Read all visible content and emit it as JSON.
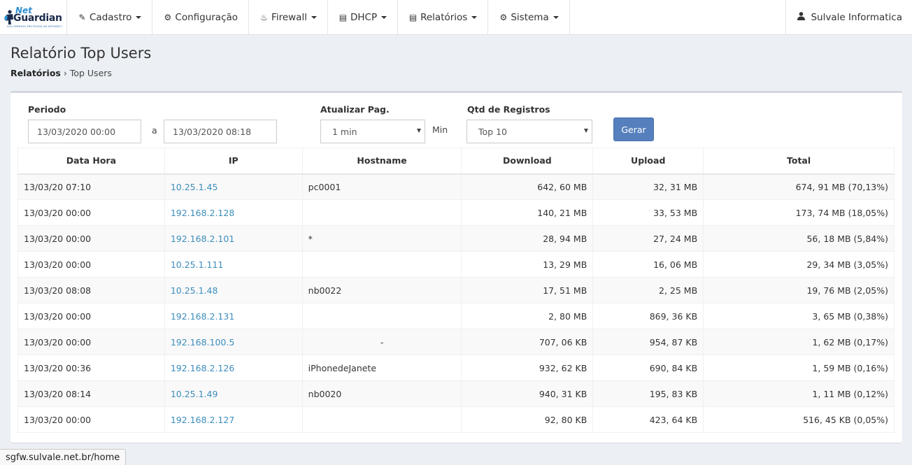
{
  "brand": {
    "logo_line1": "Net",
    "logo_line2": "Guardian",
    "logo_tagline": "SUA EMPRESA PROTEGIDA NA INTERNET!"
  },
  "nav": {
    "items": [
      {
        "label": "Cadastro",
        "icon": "edit-icon",
        "glyph": "✎",
        "dropdown": true
      },
      {
        "label": "Configuração",
        "icon": "gear-icon",
        "glyph": "⚙",
        "dropdown": false
      },
      {
        "label": "Firewall",
        "icon": "fire-icon",
        "glyph": "♨",
        "dropdown": true
      },
      {
        "label": "DHCP",
        "icon": "file-icon",
        "glyph": "▤",
        "dropdown": true
      },
      {
        "label": "Relatórios",
        "icon": "report-icon",
        "glyph": "▤",
        "dropdown": true
      },
      {
        "label": "Sistema",
        "icon": "gears-icon",
        "glyph": "⚙",
        "dropdown": true
      }
    ],
    "user": {
      "label": "Sulvale Informatica",
      "icon": "user-icon",
      "glyph": "👤"
    }
  },
  "page": {
    "title": "Relatório Top Users",
    "breadcrumb_parent": "Relatórios",
    "breadcrumb_separator": "›",
    "breadcrumb_current": "Top Users"
  },
  "filters": {
    "periodo_label": "Periodo",
    "date_from": "13/03/2020 00:00",
    "date_sep": "a",
    "date_to": "13/03/2020 08:18",
    "atualizar_label": "Atualizar Pag.",
    "atualizar_value": "1 min",
    "atualizar_unit": "Min",
    "qtd_label": "Qtd de Registros",
    "qtd_value": "Top 10",
    "gerar_label": "Gerar"
  },
  "table": {
    "columns": [
      "Data Hora",
      "IP",
      "Hostname",
      "Download",
      "Upload",
      "Total"
    ],
    "rows": [
      {
        "datahora": "13/03/20 07:10",
        "ip": "10.25.1.45",
        "hostname": "pc0001",
        "hostname_align": "left",
        "download": "642, 60 MB",
        "upload": "32, 31 MB",
        "total": "674, 91 MB (70,13%)"
      },
      {
        "datahora": "13/03/20 00:00",
        "ip": "192.168.2.128",
        "hostname": "",
        "hostname_align": "left",
        "download": "140, 21 MB",
        "upload": "33, 53 MB",
        "total": "173, 74 MB (18,05%)"
      },
      {
        "datahora": "13/03/20 00:00",
        "ip": "192.168.2.101",
        "hostname": "*",
        "hostname_align": "left",
        "download": "28, 94 MB",
        "upload": "27, 24 MB",
        "total": "56, 18 MB (5,84%)"
      },
      {
        "datahora": "13/03/20 00:00",
        "ip": "10.25.1.111",
        "hostname": "",
        "hostname_align": "left",
        "download": "13, 29 MB",
        "upload": "16, 06 MB",
        "total": "29, 34 MB (3,05%)"
      },
      {
        "datahora": "13/03/20 08:08",
        "ip": "10.25.1.48",
        "hostname": "nb0022",
        "hostname_align": "left",
        "download": "17, 51 MB",
        "upload": "2, 25 MB",
        "total": "19, 76 MB (2,05%)"
      },
      {
        "datahora": "13/03/20 00:00",
        "ip": "192.168.2.131",
        "hostname": "",
        "hostname_align": "left",
        "download": "2, 80 MB",
        "upload": "869, 36 KB",
        "total": "3, 65 MB (0,38%)"
      },
      {
        "datahora": "13/03/20 00:00",
        "ip": "192.168.100.5",
        "hostname": "-",
        "hostname_align": "center",
        "download": "707, 06 KB",
        "upload": "954, 87 KB",
        "total": "1, 62 MB (0,17%)"
      },
      {
        "datahora": "13/03/20 00:36",
        "ip": "192.168.2.126",
        "hostname": "iPhonedeJanete",
        "hostname_align": "left",
        "download": "932, 62 KB",
        "upload": "690, 84 KB",
        "total": "1, 59 MB (0,16%)"
      },
      {
        "datahora": "13/03/20 08:14",
        "ip": "10.25.1.49",
        "hostname": "nb0020",
        "hostname_align": "left",
        "download": "940, 31 KB",
        "upload": "195, 83 KB",
        "total": "1, 11 MB (0,12%)"
      },
      {
        "datahora": "13/03/20 00:00",
        "ip": "192.168.2.127",
        "hostname": "",
        "hostname_align": "left",
        "download": "92, 80 KB",
        "upload": "423, 64 KB",
        "total": "516, 45 KB (0,05%)"
      }
    ]
  },
  "status_bar": {
    "url": "sgfw.sulvale.net.br/home"
  }
}
